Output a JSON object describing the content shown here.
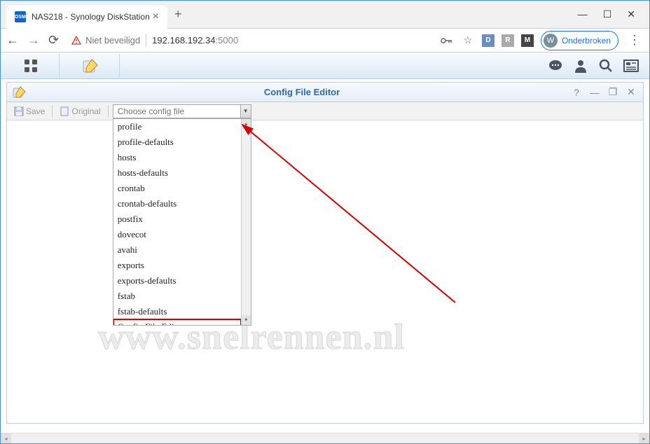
{
  "browser": {
    "tab_title": "NAS218 - Synology DiskStation",
    "security_text": "Niet beveiligd",
    "url_host": "192.168.192.34",
    "url_port": ":5000",
    "user_initial": "W",
    "user_label": "Onderbroken"
  },
  "window": {
    "title": "Config File Editor"
  },
  "toolbar": {
    "save_label": "Save",
    "original_label": "Original",
    "combo_placeholder": "Choose config file"
  },
  "dropdown": {
    "items": [
      "profile",
      "profile-defaults",
      "hosts",
      "hosts-defaults",
      "crontab",
      "crontab-defaults",
      "postfix",
      "dovecot",
      "avahi",
      "exports",
      "exports-defaults",
      "fstab",
      "fstab-defaults",
      "Config File Editor"
    ],
    "highlighted_index": 13
  },
  "watermark": "www.snelrennen.nl"
}
